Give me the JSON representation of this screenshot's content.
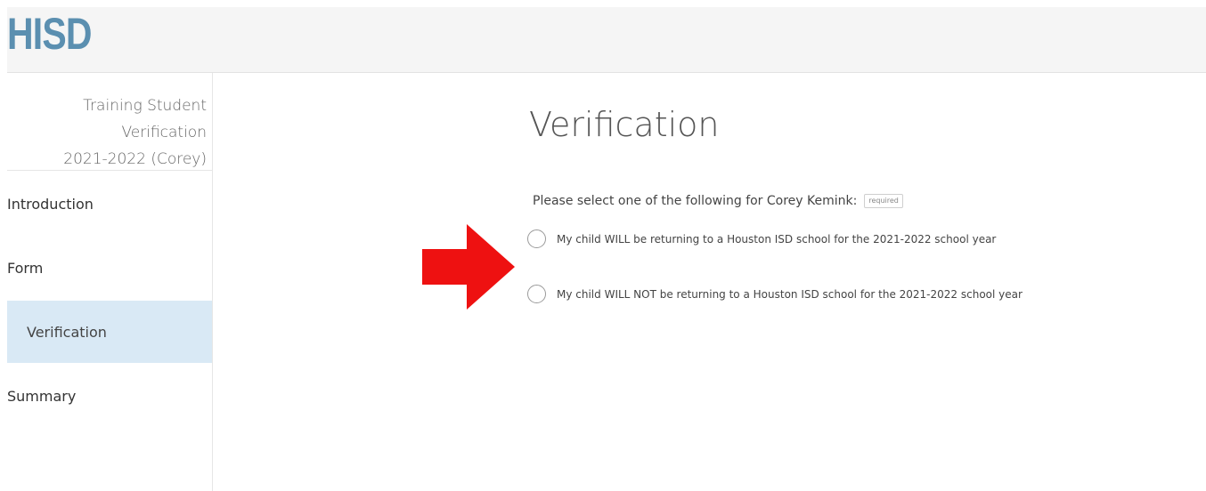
{
  "header": {
    "logo_text": "HISD"
  },
  "sidebar": {
    "title_line1": "Training Student Verification",
    "title_line2": "2021-2022 (Corey)",
    "items": [
      {
        "label": "Introduction",
        "active": false
      },
      {
        "label": "Form",
        "active": false
      },
      {
        "label": "Verification",
        "active": true
      },
      {
        "label": "Summary",
        "active": false
      }
    ]
  },
  "main": {
    "title": "Verification",
    "question": "Please select one of the following for Corey Kemink:",
    "required_label": "required",
    "options": [
      {
        "label": "My child WILL be returning to a Houston ISD school for the 2021-2022 school year",
        "selected": false
      },
      {
        "label": "My child WILL NOT be returning to a Houston ISD school for the 2021-2022 school year",
        "selected": false
      }
    ]
  },
  "colors": {
    "logo": "#5b8fb0",
    "active_nav": "#d9e9f5",
    "arrow": "#ee1111"
  },
  "icons": {
    "annotation": "red-arrow-icon"
  }
}
